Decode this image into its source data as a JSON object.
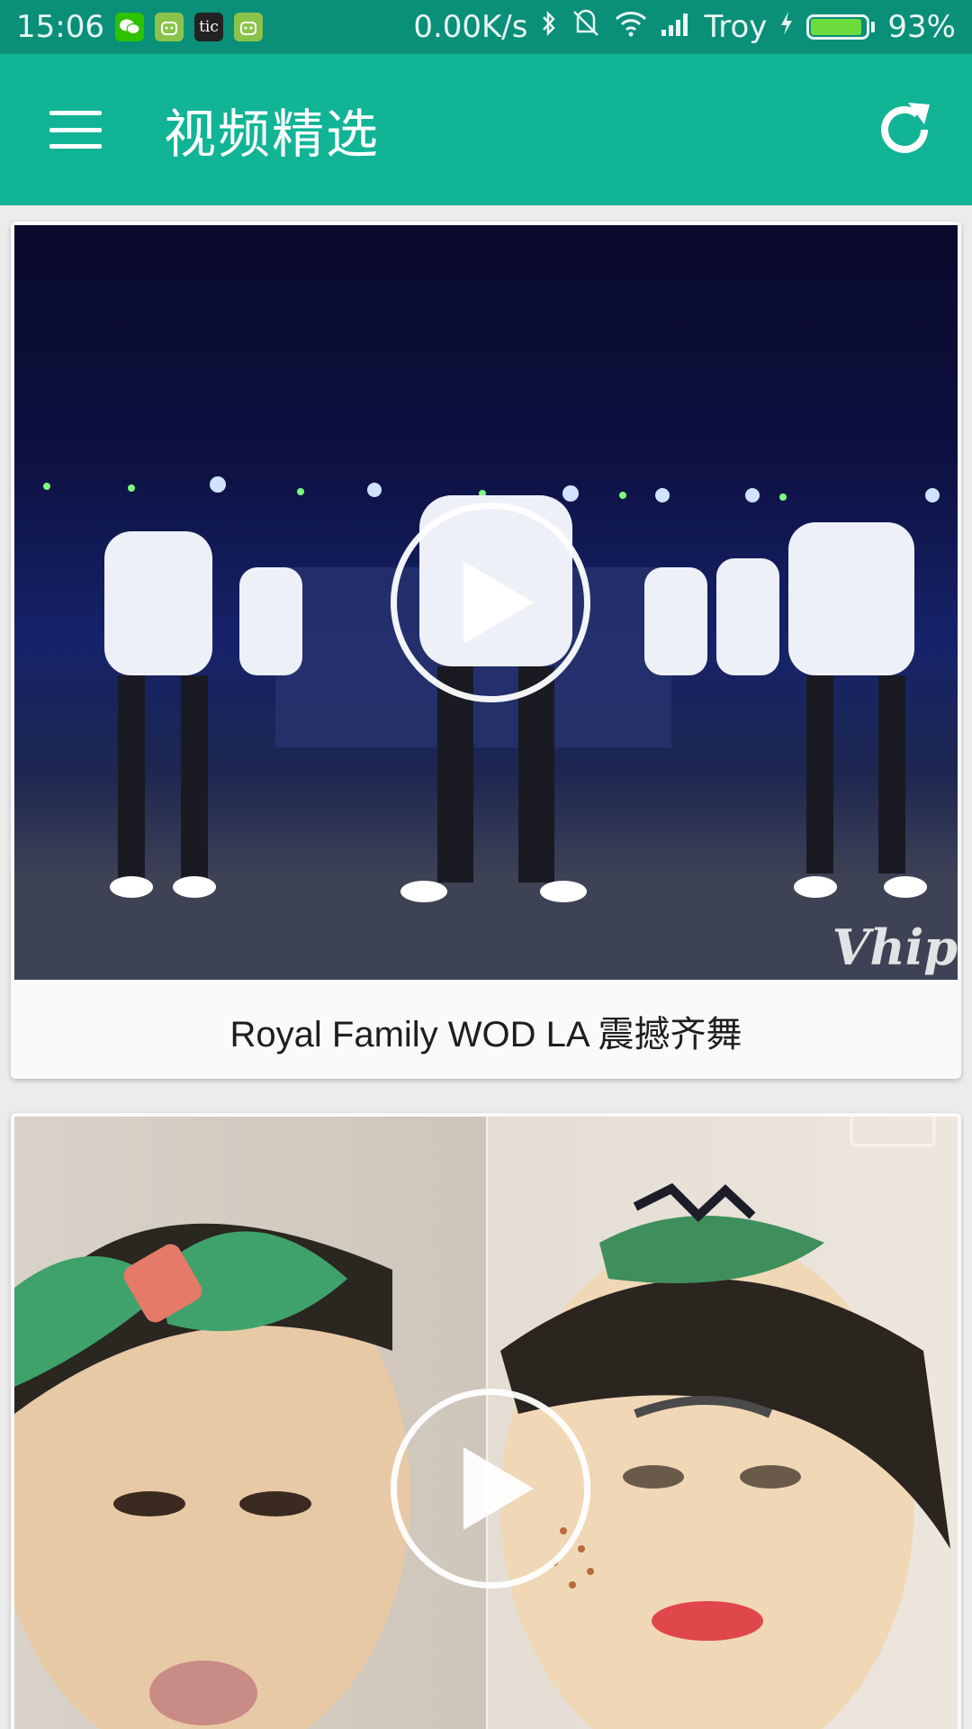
{
  "status_bar": {
    "time": "15:06",
    "notification_icons": [
      "wechat-icon",
      "android-icon",
      "tic-icon",
      "android-icon"
    ],
    "tic_label": "tic",
    "network_speed": "0.00K/s",
    "carrier": "Troy",
    "battery_percent": "93%",
    "battery_level": 0.93
  },
  "app_bar": {
    "title": "视频精选",
    "menu_icon": "hamburger-menu-icon",
    "refresh_icon": "refresh-icon",
    "background_color": "#12b496"
  },
  "feed": {
    "items": [
      {
        "title": "Royal Family WOD LA 震撼齐舞",
        "watermark": "Vhip",
        "play_icon": "play-icon"
      },
      {
        "title": "",
        "play_icon": "play-icon"
      }
    ]
  }
}
